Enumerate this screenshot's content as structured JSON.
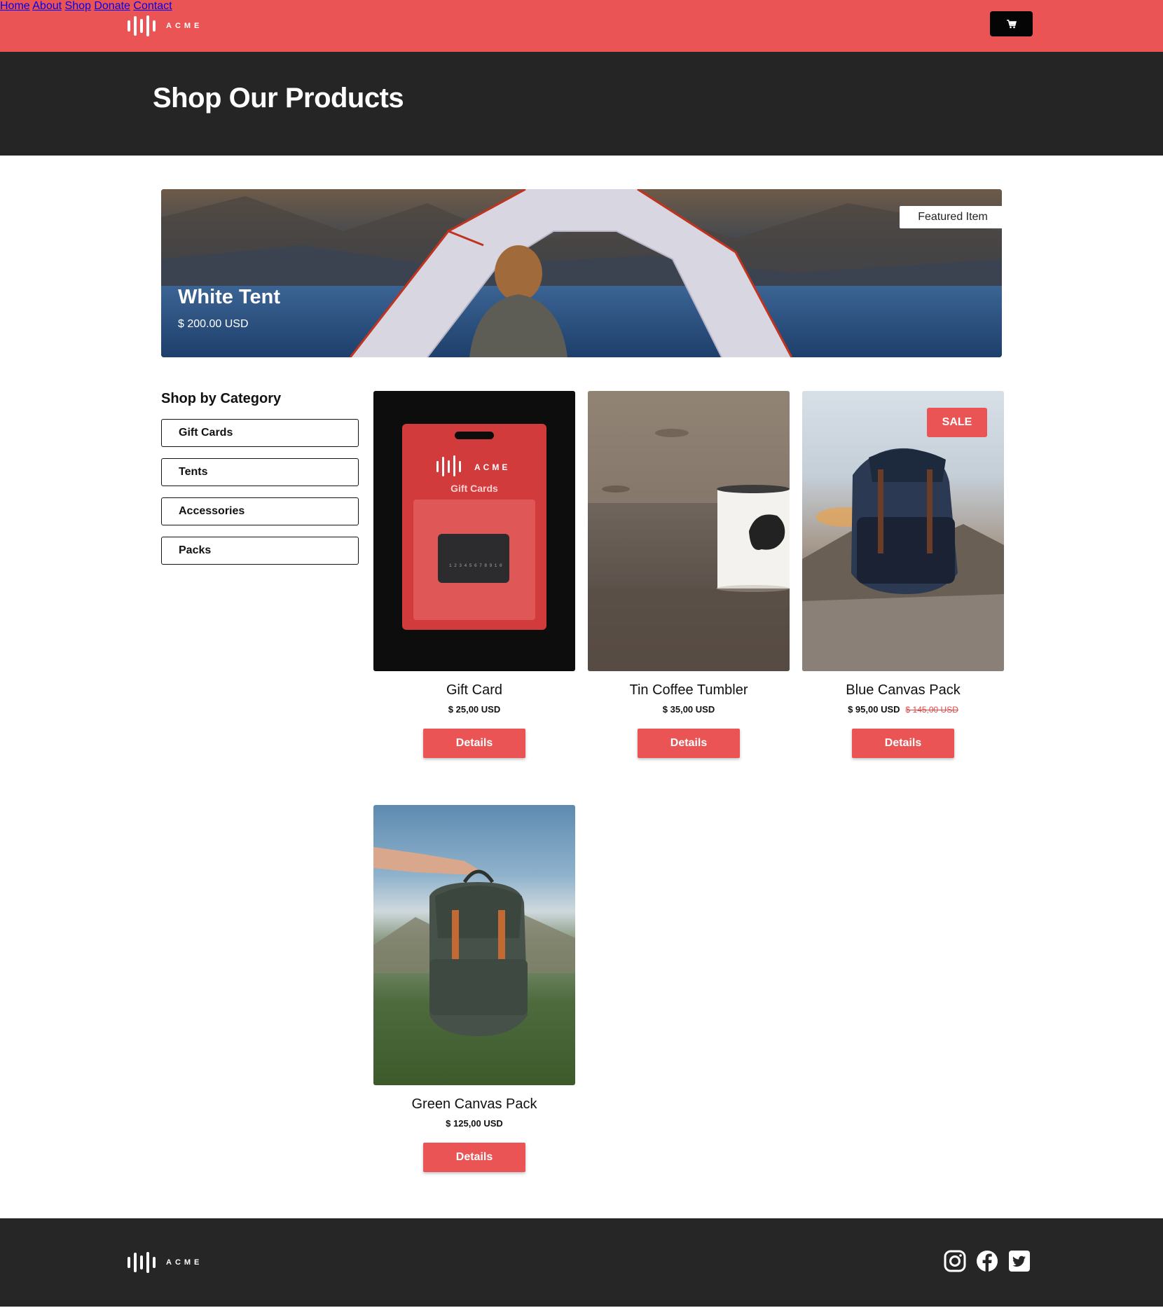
{
  "brand": {
    "name": "ACME"
  },
  "nav": {
    "links": [
      "Home",
      "About",
      "Shop",
      "Donate",
      "Contact"
    ],
    "cart_icon": "shopping-cart-icon"
  },
  "hero": {
    "title": "Shop Our Products"
  },
  "featured": {
    "badge": "Featured Item",
    "title": "White Tent",
    "price": "$ 200.00 USD"
  },
  "sidebar": {
    "title": "Shop by Category",
    "categories": [
      "Gift Cards",
      "Tents",
      "Accessories",
      "Packs"
    ]
  },
  "products": [
    {
      "name": "Gift Card",
      "price": "$ 25,00 USD",
      "old_price": "",
      "sale": "",
      "button": "Details",
      "card_text": {
        "brand": "ACME",
        "label": "Gift Cards",
        "number": "1 2 3 4 5 6 7 8 9 1 0"
      }
    },
    {
      "name": "Tin Coffee Tumbler",
      "price": "$ 35,00 USD",
      "old_price": "",
      "sale": "",
      "button": "Details"
    },
    {
      "name": "Blue Canvas Pack",
      "price": "$ 95,00 USD",
      "old_price": "$ 145,00 USD",
      "sale": "SALE",
      "button": "Details"
    },
    {
      "name": "Green Canvas Pack",
      "price": "$ 125,00 USD",
      "old_price": "",
      "sale": "",
      "button": "Details"
    }
  ],
  "footer": {
    "social": [
      "instagram-icon",
      "facebook-icon",
      "twitter-icon"
    ]
  },
  "colors": {
    "accent": "#ea5454",
    "dark": "#252525",
    "footer": "#262626"
  }
}
